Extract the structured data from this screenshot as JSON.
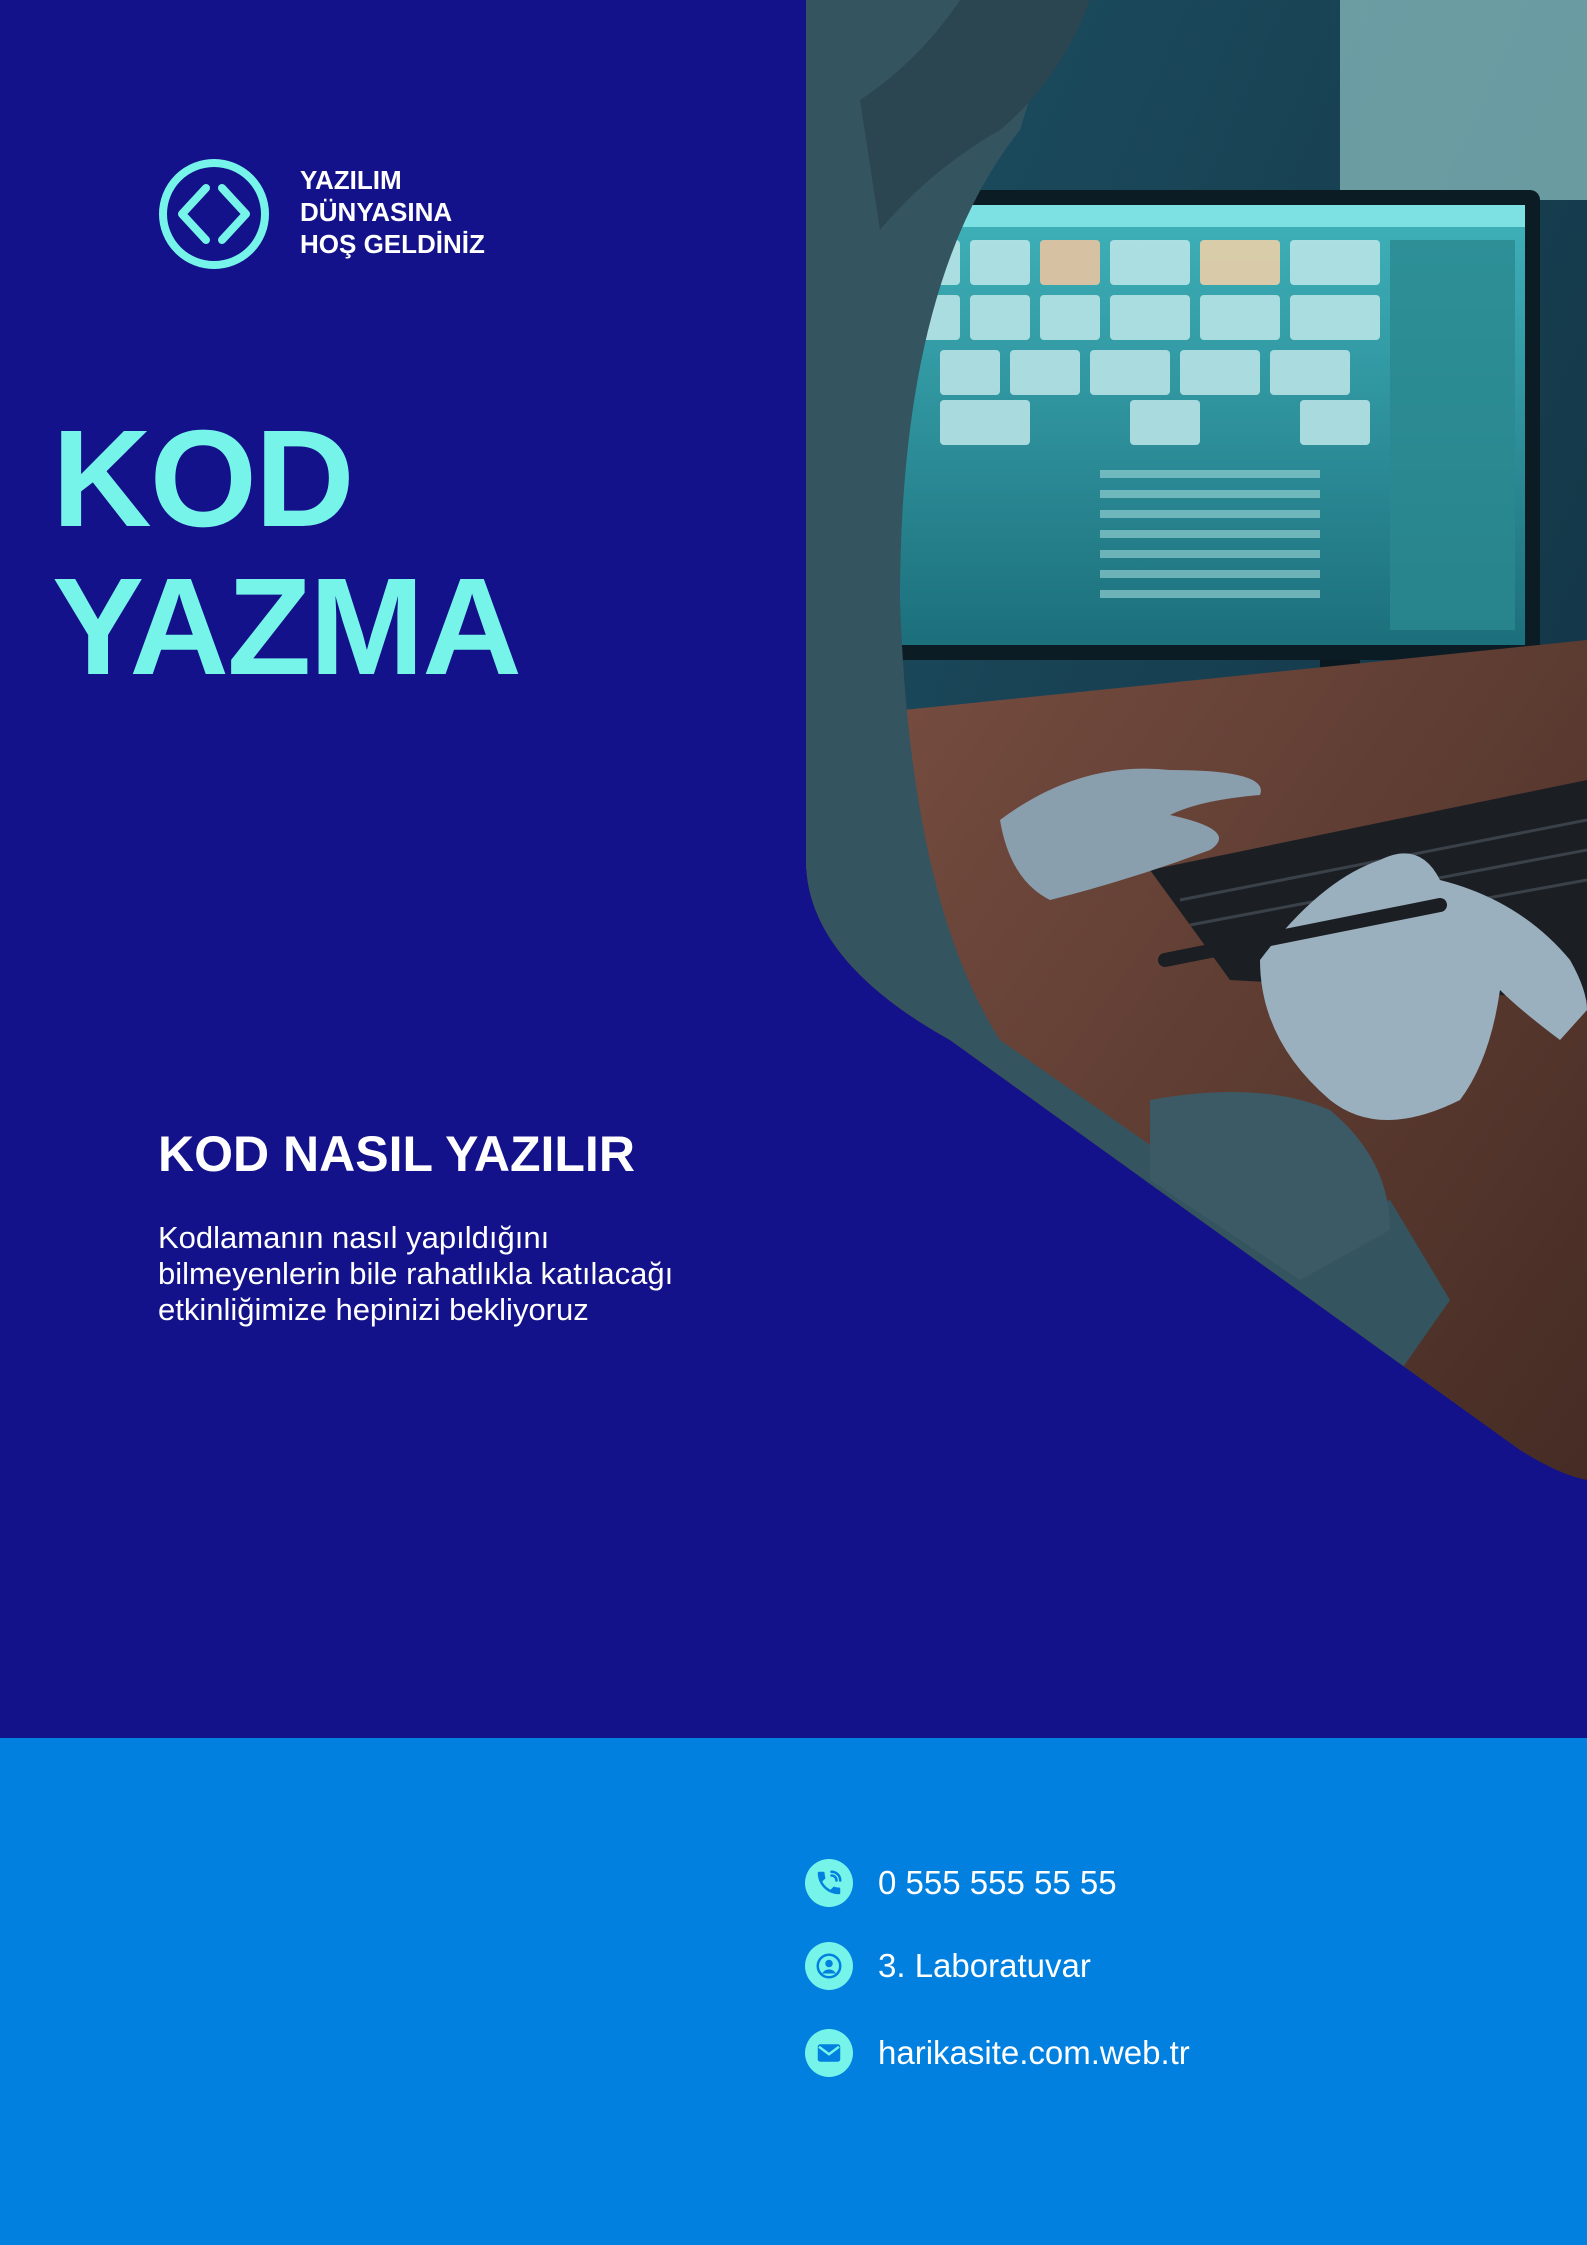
{
  "header": {
    "logo_lines": [
      "YAZILIM",
      "DÜNYASINA",
      "HOŞ GELDİNİZ"
    ],
    "logo_icon": "code-brackets-icon"
  },
  "hero": {
    "line1": "KOD",
    "line2": "YAZMA"
  },
  "section": {
    "title": "KOD NASIL YAZILIR",
    "description_lines": [
      "Kodlamanın nasıl yapıldığını",
      "bilmeyenlerin bile rahatlıkla katılacağı",
      "etkinliğimize hepinizi bekliyoruz"
    ]
  },
  "contacts": [
    {
      "icon": "phone-icon",
      "text": "0 555 555 55 55"
    },
    {
      "icon": "user-location-icon",
      "text": "3. Laboratuvar"
    },
    {
      "icon": "mail-icon",
      "text": "harikasite.com.web.tr"
    }
  ],
  "colors": {
    "navy": "#13128a",
    "blue": "#0180e0",
    "accent": "#76f4e9",
    "text": "#ffffff"
  }
}
